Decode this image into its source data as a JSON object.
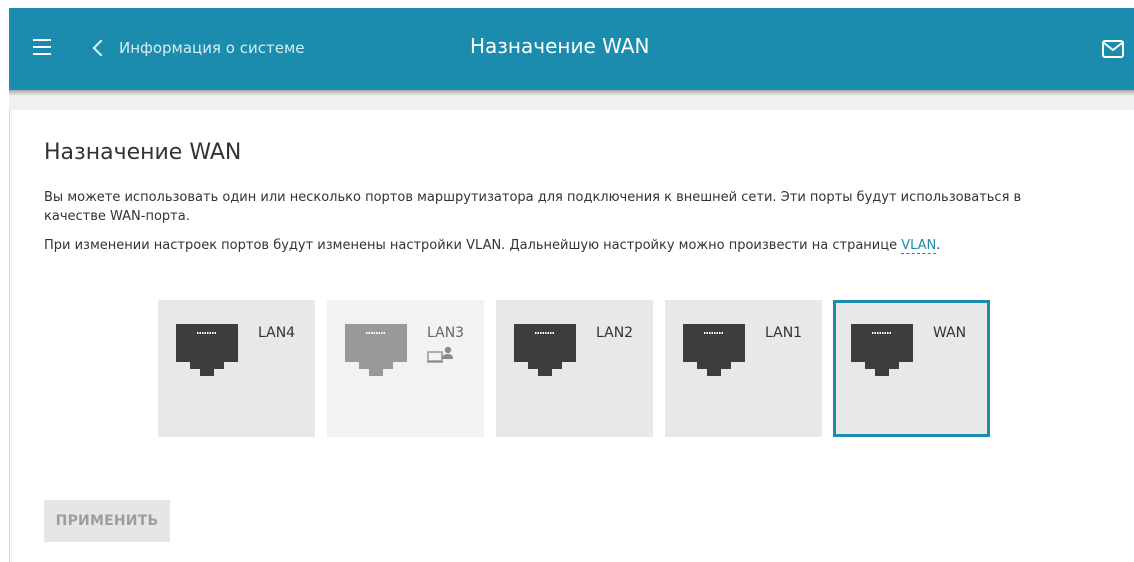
{
  "header": {
    "back_label": "Информация о системе",
    "title": "Назначение WAN",
    "color": "#1b8cad"
  },
  "page": {
    "title": "Назначение WAN",
    "description_1": "Вы можете использовать один или несколько портов маршрутизатора для подключения к внешней сети. Эти порты будут использоваться в качестве WAN-порта.",
    "description_2_prefix": "При изменении настроек портов будут изменены настройки VLAN. Дальнейшую настройку можно произвести на странице ",
    "vlan_link": "VLAN",
    "description_2_suffix": "."
  },
  "ports": [
    {
      "label": "LAN4",
      "state": "available"
    },
    {
      "label": "LAN3",
      "state": "disabled",
      "badge_icon": "connected-device-icon"
    },
    {
      "label": "LAN2",
      "state": "available"
    },
    {
      "label": "LAN1",
      "state": "available"
    },
    {
      "label": "WAN",
      "state": "selected"
    }
  ],
  "apply_button": {
    "label": "ПРИМЕНИТЬ",
    "enabled": false
  },
  "icons": {
    "menu": "hamburger-menu-icon",
    "back": "chevron-left-icon",
    "notifications": "mail-icon",
    "port": "ethernet-port-icon"
  }
}
